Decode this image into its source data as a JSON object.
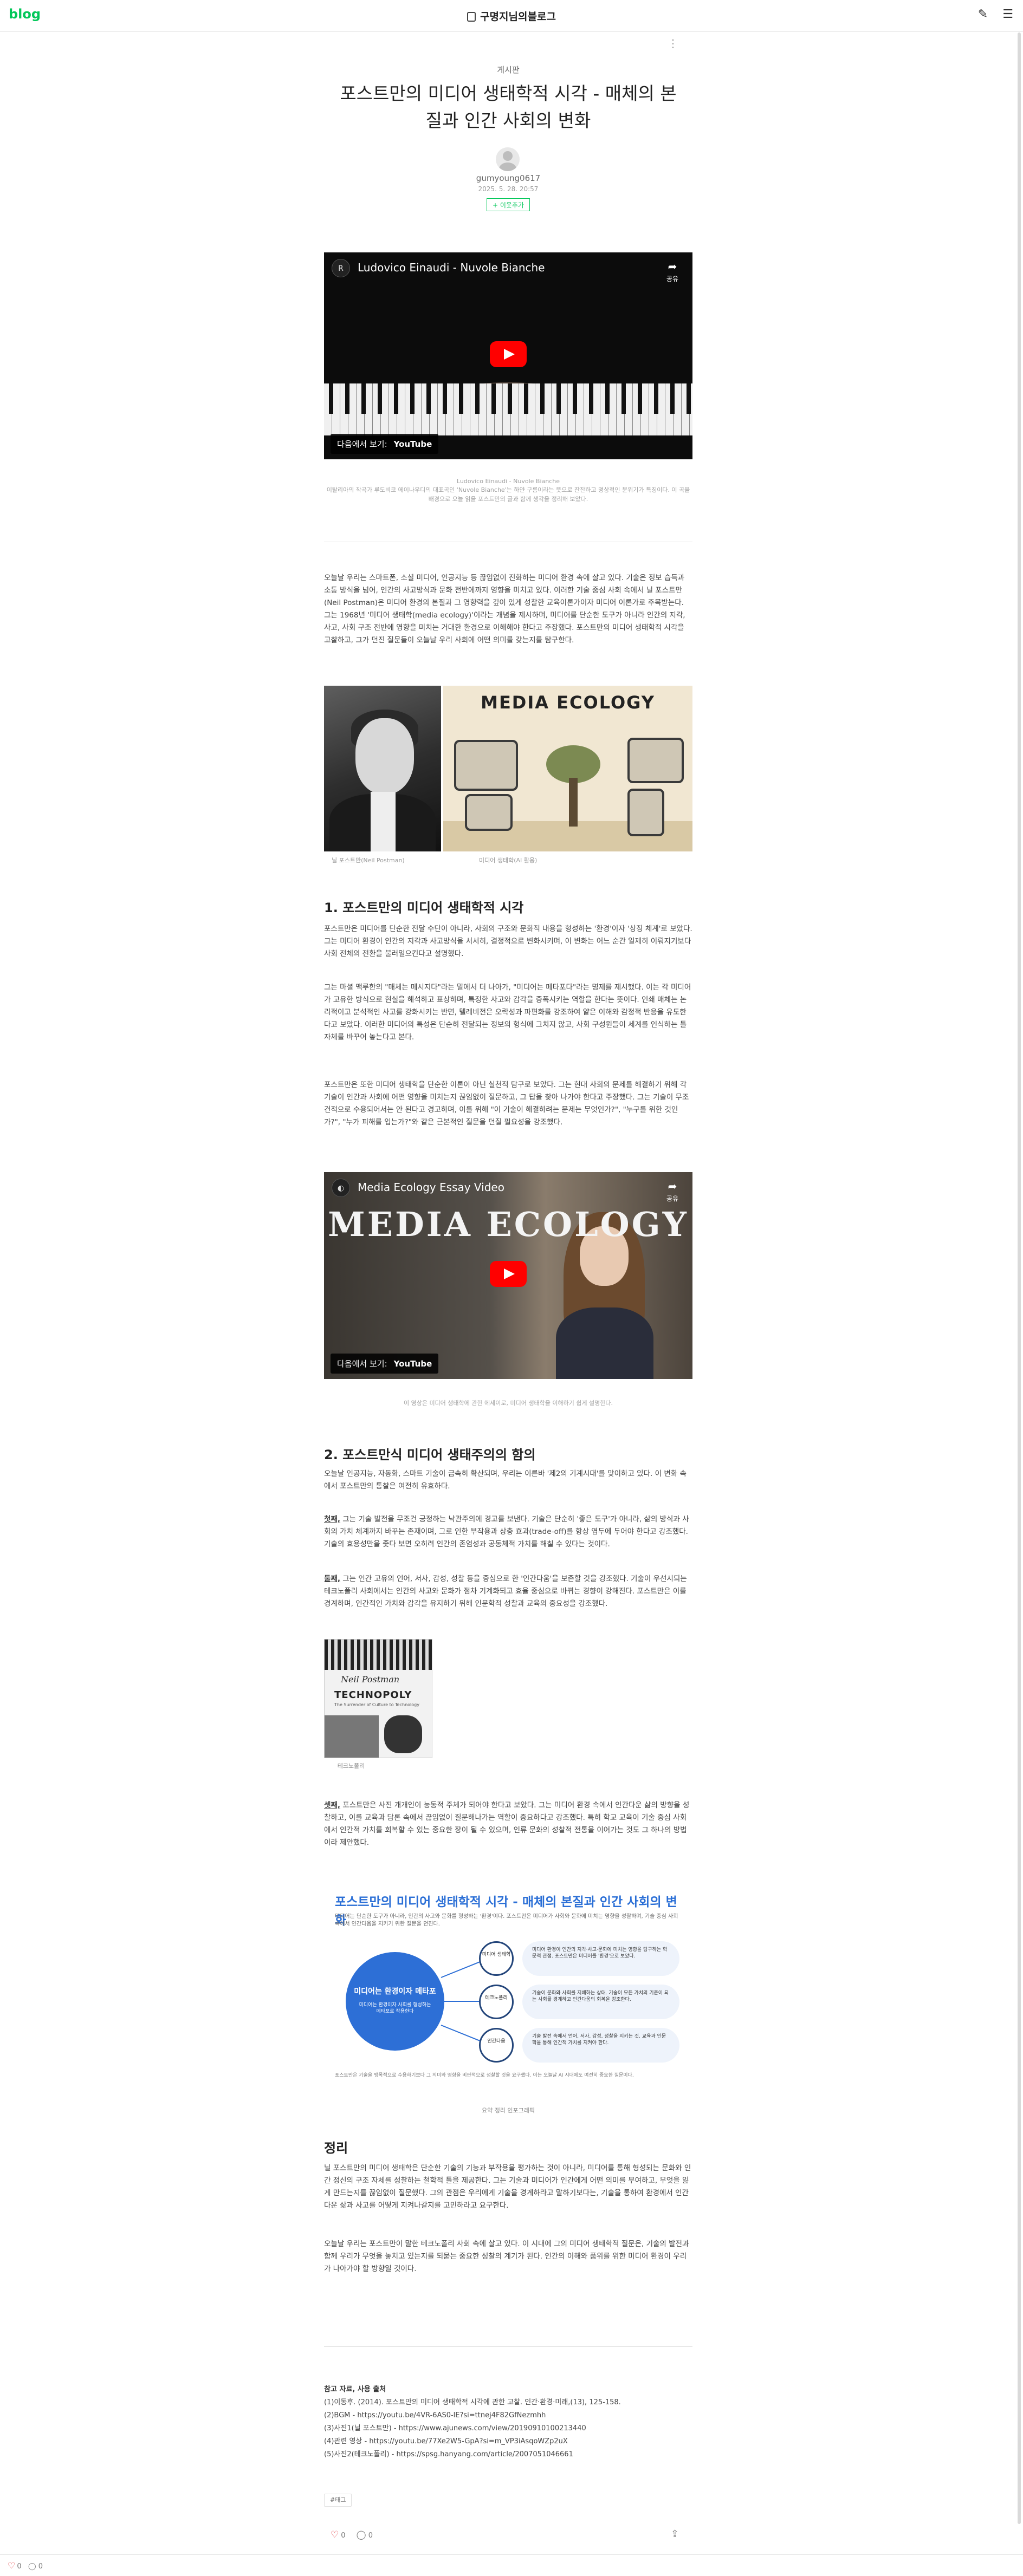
{
  "topbar": {
    "logo": "blog",
    "blog_name": "구명지님의블로그",
    "icons": [
      "write-icon",
      "menu-icon"
    ]
  },
  "post": {
    "category": "게시판",
    "title": "포스트만의 미디어 생태학적 시각 - 매체의 본질과 인간 사회의 변화",
    "author": "gumyoung0617",
    "date": "2025. 5. 28. 20:57",
    "neighbor_button": "+ 이웃추가"
  },
  "video1": {
    "title": "Ludovico Einaudi - Nuvole Bianche",
    "share_label": "공유",
    "watch_on": "다음에서 보기:",
    "watch_brand": "YouTube",
    "caption_title": "Ludovico Einaudi - Nuvole Bianche",
    "caption_desc": "이탈리아의 작곡가 루도비코 에이나우디의 대표곡인 'Nuvole Bianche'는 하얀 구름이라는 뜻으로 잔잔하고 명상적인 분위기가 특징이다. 이 곡을 배경으로 오늘 읽을 포스트만의 글과 함께 생각을 정리해 보았다."
  },
  "intro": "오늘날 우리는 스마트폰, 소셜 미디어, 인공지능 등 끊임없이 진화하는 미디어 환경 속에 살고 있다. 기술은 정보 습득과 소통 방식을 넘어, 인간의 사고방식과 문화 전반에까지 영향을 미치고 있다. 이러한 기술 중심 사회 속에서 닐 포스트만(Neil Postman)은 미디어 환경의 본질과 그 영향력을 깊이 있게 성찰한 교육이론가이자 미디어 이론가로 주목받는다. 그는 1968년 '미디어 생태학(media ecology)'이라는 개념을 제시하며, 미디어를 단순한 도구가 아니라 인간의 지각, 사고, 사회 구조 전반에 영향을 미치는 거대한 환경으로 이해해야 한다고 주장했다. 포스트만의 미디어 생태학적 시각을 고찰하고, 그가 던진 질문들이 오늘날 우리 사회에 어떤 의미를 갖는지를 탐구한다.",
  "images1": {
    "ecology_title": "MEDIA ECOLOGY",
    "caption_left": "닐 포스트만(Neil Postman)",
    "caption_right": "미디어 생태학(AI 활용)"
  },
  "section1": {
    "heading": "1. 포스트만의 미디어 생태학적 시각",
    "p1": "포스트만은 미디어를 단순한 전달 수단이 아니라, 사회의 구조와 문화적 내용을 형성하는 '환경'이자 '상징 체계'로 보았다. 그는 미디어 환경이 인간의 지각과 사고방식을 서서히, 결정적으로 변화시키며, 이 변화는 어느 순간 일제히 이뤄지기보다 사회 전체의 전환을 불러일으킨다고 설명했다.",
    "p2": "그는 마셜 맥루한의 \"매체는 메시지다\"라는 말에서 더 나아가, \"미디어는 메타포다\"라는 명제를 제시했다. 이는 각 미디어가 고유한 방식으로 현실을 해석하고 표상하며, 특정한 사고와 감각을 증폭시키는 역할을 한다는 뜻이다. 인쇄 매체는 논리적이고 분석적인 사고를 강화시키는 반면, 텔레비전은 오락성과 파편화를 강조하여 얕은 이해와 감정적 반응을 유도한다고 보았다. 이러한 미디어의 특성은 단순히 전달되는 정보의 형식에 그치지 않고, 사회 구성원들이 세계를 인식하는 틀 자체를 바꾸어 놓는다고 본다.",
    "p3": "포스트만은 또한 미디어 생태학을 단순한 이론이 아닌 실천적 탐구로 보았다. 그는 현대 사회의 문제를 해결하기 위해 각 기술이 인간과 사회에 어떤 영향을 미치는지 끊임없이 질문하고, 그 답을 찾아 나가야 한다고 주장했다. 그는 기술이 무조건적으로 수용되어서는 안 된다고 경고하며, 이를 위해 \"이 기술이 해결하려는 문제는 무엇인가?\", \"누구를 위한 것인가?\", \"누가 피해를 입는가?\"와 같은 근본적인 질문을 던질 필요성을 강조했다."
  },
  "video2": {
    "title": "Media Ecology Essay Video",
    "overlay": "MEDIA ECOLOGY",
    "watch_on": "다음에서 보기:",
    "watch_brand": "YouTube",
    "caption": "이 영상은 미디어 생태학에 관한 에세이로, 미디어 생태학을 이해하기 쉽게 설명한다."
  },
  "section2": {
    "heading": "2. 포스트만식 미디어 생태주의의 함의",
    "p1": "오늘날 인공지능, 자동화, 스마트 기술이 급속히 확산되며, 우리는 이른바 '제2의 기계시대'를 맞이하고 있다. 이 변화 속에서 포스트만의 통찰은 여전히 유효하다.",
    "p2_lead": "첫째,",
    "p2": " 그는 기술 발전을 무조건 긍정하는 낙관주의에 경고를 보낸다. 기술은 단순히 '좋은 도구'가 아니라, 삶의 방식과 사회의 가치 체계까지 바꾸는 존재이며, 그로 인한 부작용과 상충 효과(trade-off)를 항상 염두에 두어야 한다고 강조했다. 기술의 효용성만을 좇다 보면 오히려 인간의 존엄성과 공동체적 가치를 해칠 수 있다는 것이다.",
    "p3_lead": "둘째,",
    "p3": " 그는 인간 고유의 언어, 서사, 감성, 성찰 등을 중심으로 한 '인간다움'을 보존할 것을 강조했다. 기술이 우선시되는 테크노폴리 사회에서는 인간의 사고와 문화가 점차 기계화되고 효율 중심으로 바뀌는 경향이 강해진다. 포스트만은 이를 경계하며, 인간적인 가치와 감각을 유지하기 위해 인문학적 성찰과 교육의 중요성을 강조했다.",
    "technopoly_caption": "테크노폴리",
    "technopoly_author": "Neil Postman",
    "technopoly_title": "TECHNOPOLY",
    "technopoly_sub": "The Surrender of Culture to Technology",
    "p4_lead": "셋째,",
    "p4": " 포스트만은 사진 개개인이 능동적 주체가 되어야 한다고 보았다. 그는 미디어 환경 속에서 인간다운 삶의 방향을 성찰하고, 이를 교육과 담론 속에서 끊임없이 질문해나가는 역할이 중요하다고 강조했다. 특히 학교 교육이 기술 중심 사회에서 인간적 가치를 회복할 수 있는 중요한 장이 될 수 있으며, 인류 문화의 성찰적 전통을 이어가는 것도 그 하나의 방법이라 제안했다."
  },
  "infographic": {
    "title": "포스트만의 미디어 생태학적 시각 - 매체의 본질과 인간 사회의 변화",
    "subtitle": "미디어는 단순한 도구가 아니라, 인간의 사고와 문화를 형성하는 '환경'이다. 포스트만은 미디어가 사회와 문화에 미치는 영향을 성찰하며, 기술 중심 사회 속에서 인간다움을 지키기 위한 질문을 던진다.",
    "center_title": "미디어는 환경이자 메타포",
    "center_sub": "미디어는 환경이자 사회를 형성하는 메타포로 작용한다",
    "nodes": [
      {
        "label": "미디어 생태학",
        "text": "미디어 환경이 인간의 지각·사고·문화에 미치는 영향을 탐구하는 학문적 관점. 포스트만은 미디어를 '환경'으로 보았다."
      },
      {
        "label": "테크노폴리",
        "text": "기술이 문화와 사회를 지배하는 상태. 기술이 모든 가치의 기준이 되는 사회를 경계하고 인간다움의 회복을 강조한다."
      },
      {
        "label": "인간다움",
        "text": "기술 발전 속에서 언어, 서사, 감성, 성찰을 지키는 것. 교육과 인문학을 통해 인간적 가치를 지켜야 한다."
      }
    ],
    "footer": "포스트만은 기술을 맹목적으로 수용하기보다 그 의미와 영향을 비판적으로 성찰할 것을 요구했다. 이는 오늘날 AI 시대에도 여전히 중요한 질문이다.",
    "caption": "요약 정리 인포그래픽"
  },
  "conclusion": {
    "heading": "정리",
    "p1": "닐 포스트만의 미디어 생태학은 단순한 기술의 기능과 부작용을 평가하는 것이 아니라, 미디어를 통해 형성되는 문화와 인간 정신의 구조 자체를 성찰하는 철학적 틀을 제공한다. 그는 기술과 미디어가 인간에게 어떤 의미를 부여하고, 무엇을 잃게 만드는지를 끊임없이 질문했다. 그의 관점은 우리에게 기술을 경계하라고 말하기보다는, 기술을 통하여 환경에서 인간다운 삶과 사고를 어떻게 지켜나갈지를 고민하라고 요구한다.",
    "p2": "오늘날 우리는 포스트만이 말한 테크노폴리 사회 속에 살고 있다. 이 시대에 그의 미디어 생태학적 질문은, 기술의 발전과 함께 우리가 무엇을 놓치고 있는지를 되묻는 중요한 성찰의 계기가 된다. 인간의 이해와 품위를 위한 미디어 환경이 우리가 나아가야 할 방향일 것이다."
  },
  "references": {
    "title": "참고 자료, 사용 출처",
    "items": [
      "(1)이동후. (2014). 포스트만의 미디어 생태학적 시각에 관한 고찰. 인간·환경·미래,(13), 125-158.",
      "(2)BGM - https://youtu.be/4VR-6AS0-lE?si=ttnej4F82GfNezmhh",
      "(3)사진1(닐 포스트만) - https://www.ajunews.com/view/20190910100213440",
      "(4)관련 영상 - https://youtu.be/77Xe2W5-GpA?si=m_VP3iAsqoWZp2uX",
      "(5)사진2(테크노폴리) - https://spsg.hanyang.com/article/2007051046661"
    ]
  },
  "tag": "#태그",
  "footer": {
    "likes": "0",
    "comments": "0"
  },
  "bottombar": {
    "likes": "0",
    "comments": "0"
  }
}
